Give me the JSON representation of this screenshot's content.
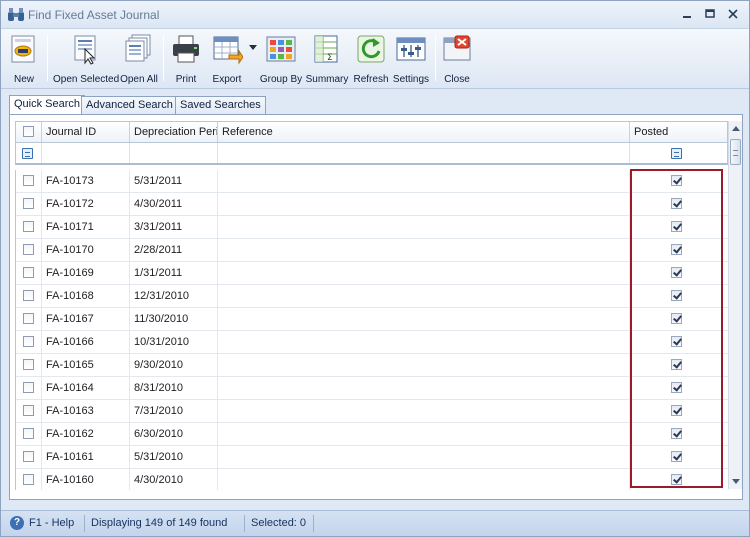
{
  "window": {
    "title": "Find Fixed Asset Journal"
  },
  "toolbar": {
    "buttons": [
      {
        "label": "New",
        "icon": "new-doc-icon"
      },
      {
        "label": "Open Selected",
        "icon": "open-selected-icon"
      },
      {
        "label": "Open All",
        "icon": "open-all-icon"
      },
      {
        "label": "Print",
        "icon": "printer-icon"
      },
      {
        "label": "Export",
        "icon": "export-grid-icon"
      },
      {
        "label": "Group By",
        "icon": "group-by-icon"
      },
      {
        "label": "Summary",
        "icon": "summary-icon"
      },
      {
        "label": "Refresh",
        "icon": "refresh-icon"
      },
      {
        "label": "Settings",
        "icon": "settings-icon"
      },
      {
        "label": "Close",
        "icon": "close-window-icon"
      }
    ]
  },
  "tabs": [
    {
      "label": "Quick Search",
      "active": true
    },
    {
      "label": "Advanced Search",
      "active": false
    },
    {
      "label": "Saved Searches",
      "active": false
    }
  ],
  "grid": {
    "columns": [
      "Journal ID",
      "Depreciation Perio",
      "Reference",
      "Posted"
    ],
    "rows": [
      {
        "id": "FA-10173",
        "period": "5/31/2011",
        "reference": "",
        "posted": true
      },
      {
        "id": "FA-10172",
        "period": "4/30/2011",
        "reference": "",
        "posted": true
      },
      {
        "id": "FA-10171",
        "period": "3/31/2011",
        "reference": "",
        "posted": true
      },
      {
        "id": "FA-10170",
        "period": "2/28/2011",
        "reference": "",
        "posted": true
      },
      {
        "id": "FA-10169",
        "period": "1/31/2011",
        "reference": "",
        "posted": true
      },
      {
        "id": "FA-10168",
        "period": "12/31/2010",
        "reference": "",
        "posted": true
      },
      {
        "id": "FA-10167",
        "period": "11/30/2010",
        "reference": "",
        "posted": true
      },
      {
        "id": "FA-10166",
        "period": "10/31/2010",
        "reference": "",
        "posted": true
      },
      {
        "id": "FA-10165",
        "period": "9/30/2010",
        "reference": "",
        "posted": true
      },
      {
        "id": "FA-10164",
        "period": "8/31/2010",
        "reference": "",
        "posted": true
      },
      {
        "id": "FA-10163",
        "period": "7/31/2010",
        "reference": "",
        "posted": true
      },
      {
        "id": "FA-10162",
        "period": "6/30/2010",
        "reference": "",
        "posted": true
      },
      {
        "id": "FA-10161",
        "period": "5/31/2010",
        "reference": "",
        "posted": true
      },
      {
        "id": "FA-10160",
        "period": "4/30/2010",
        "reference": "",
        "posted": true
      }
    ]
  },
  "status": {
    "help": "F1 - Help",
    "displaying": "Displaying 149 of 149 found",
    "selected": "Selected: 0"
  },
  "colors": {
    "highlight": "#9b1b2c",
    "accent": "#3d6fb4"
  }
}
